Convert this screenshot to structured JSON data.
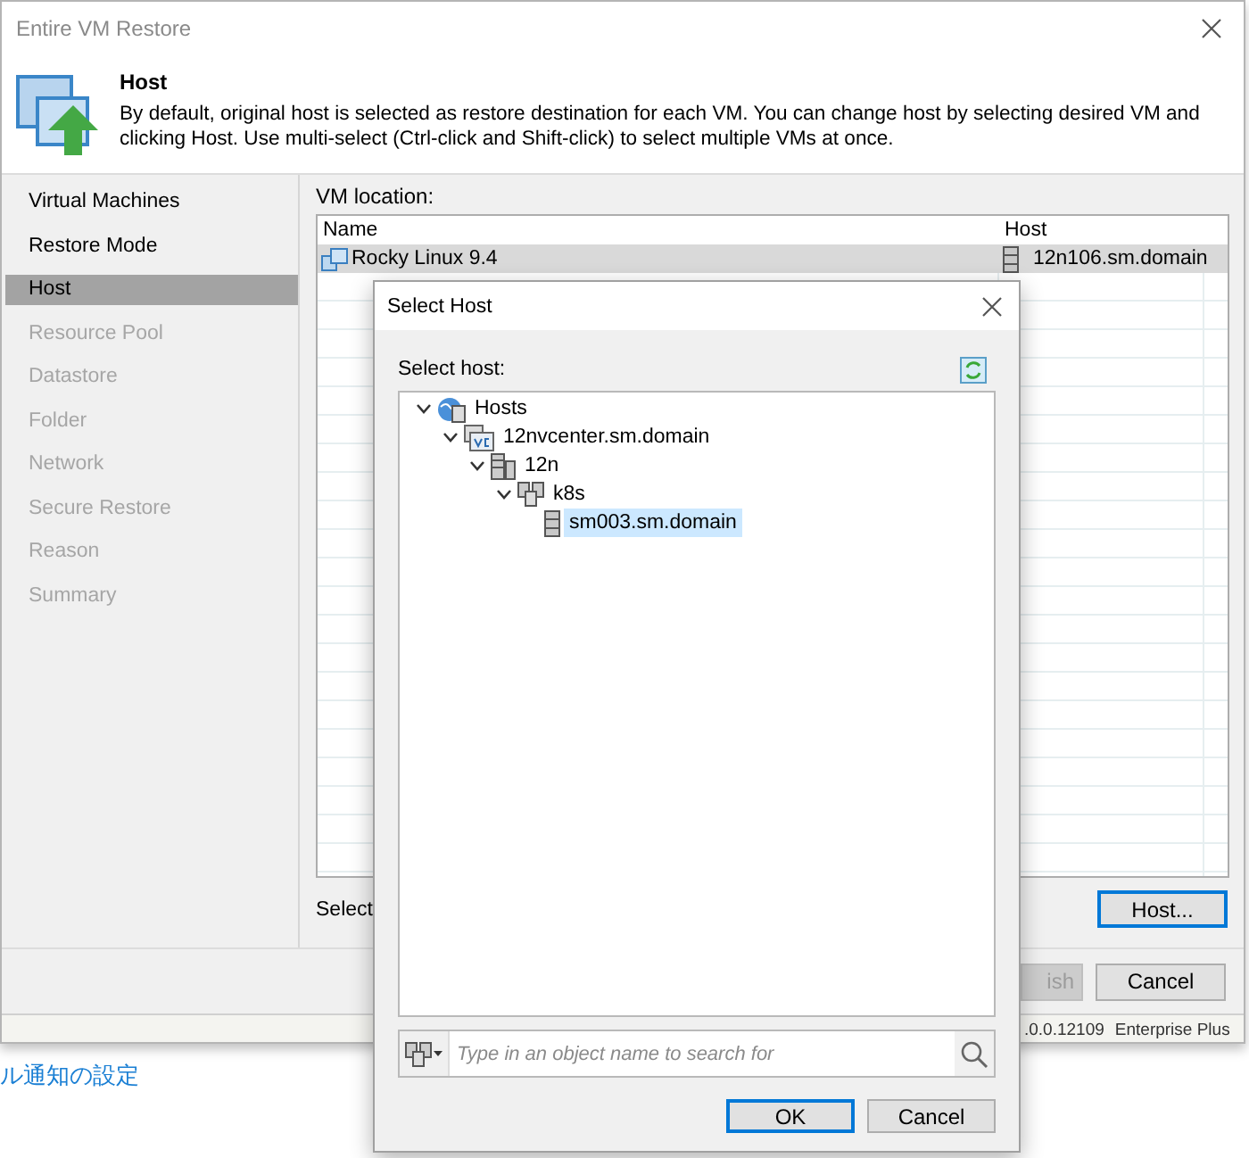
{
  "window": {
    "title": "Entire VM Restore"
  },
  "header": {
    "title": "Host",
    "description": "By default, original host is selected as restore destination for each VM. You can change host by selecting desired VM and clicking Host. Use multi-select (Ctrl-click and Shift-click) to select multiple VMs at once."
  },
  "steps": [
    {
      "label": "Virtual Machines",
      "selected": false,
      "disabled": false
    },
    {
      "label": "Restore Mode",
      "selected": false,
      "disabled": false
    },
    {
      "label": "Host",
      "selected": true,
      "disabled": false
    },
    {
      "label": "Resource Pool",
      "selected": false,
      "disabled": true
    },
    {
      "label": "Datastore",
      "selected": false,
      "disabled": true
    },
    {
      "label": "Folder",
      "selected": false,
      "disabled": true
    },
    {
      "label": "Network",
      "selected": false,
      "disabled": true
    },
    {
      "label": "Secure Restore",
      "selected": false,
      "disabled": true
    },
    {
      "label": "Reason",
      "selected": false,
      "disabled": true
    },
    {
      "label": "Summary",
      "selected": false,
      "disabled": true
    }
  ],
  "vm_location": {
    "label": "VM location:",
    "columns": [
      "Name",
      "Host"
    ],
    "rows": [
      {
        "name": "Rocky Linux 9.4",
        "host": "12n106.sm.domain",
        "selected": true
      }
    ]
  },
  "hint": "Select",
  "host_button": "Host...",
  "buttons": [
    {
      "label": "ish",
      "disabled": true
    },
    {
      "label": "Cancel",
      "disabled": false
    }
  ],
  "status_bar": [
    ".0.0.12109",
    "Enterprise Plus"
  ],
  "background_link": "ル通知の設定",
  "dialog": {
    "title": "Select Host",
    "label": "Select host:",
    "tree": [
      {
        "label": "Hosts",
        "kind": "root",
        "expanded": true,
        "selected": false,
        "children": [
          {
            "label": "12nvcenter.sm.domain",
            "kind": "vcenter",
            "expanded": true,
            "selected": false,
            "children": [
              {
                "label": "12n",
                "kind": "datacenter",
                "expanded": true,
                "selected": false,
                "children": [
                  {
                    "label": "k8s",
                    "kind": "cluster",
                    "expanded": true,
                    "selected": false,
                    "children": [
                      {
                        "label": "sm003.sm.domain",
                        "kind": "host",
                        "selected": true
                      }
                    ]
                  }
                ]
              }
            ]
          }
        ]
      }
    ],
    "search": {
      "placeholder": "Type in an object name to search for"
    },
    "buttons": [
      {
        "label": "OK",
        "default": true
      },
      {
        "label": "Cancel",
        "default": false
      }
    ]
  }
}
